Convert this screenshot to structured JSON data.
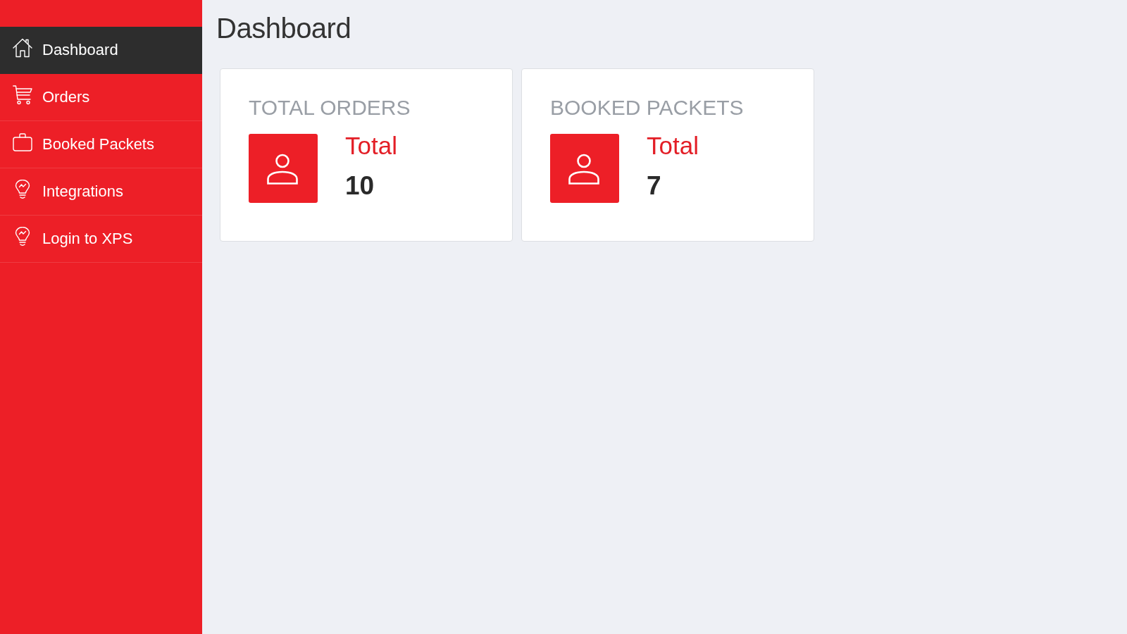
{
  "sidebar": {
    "items": [
      {
        "label": "Dashboard",
        "selected": true
      },
      {
        "label": "Orders",
        "selected": false
      },
      {
        "label": "Booked Packets",
        "selected": false
      },
      {
        "label": "Integrations",
        "selected": false
      },
      {
        "label": "Login to XPS",
        "selected": false
      }
    ]
  },
  "page": {
    "title": "Dashboard"
  },
  "cards": [
    {
      "title": "TOTAL ORDERS",
      "label": "Total",
      "value": "10"
    },
    {
      "title": "BOOKED PACKETS",
      "label": "Total",
      "value": "7"
    }
  ]
}
